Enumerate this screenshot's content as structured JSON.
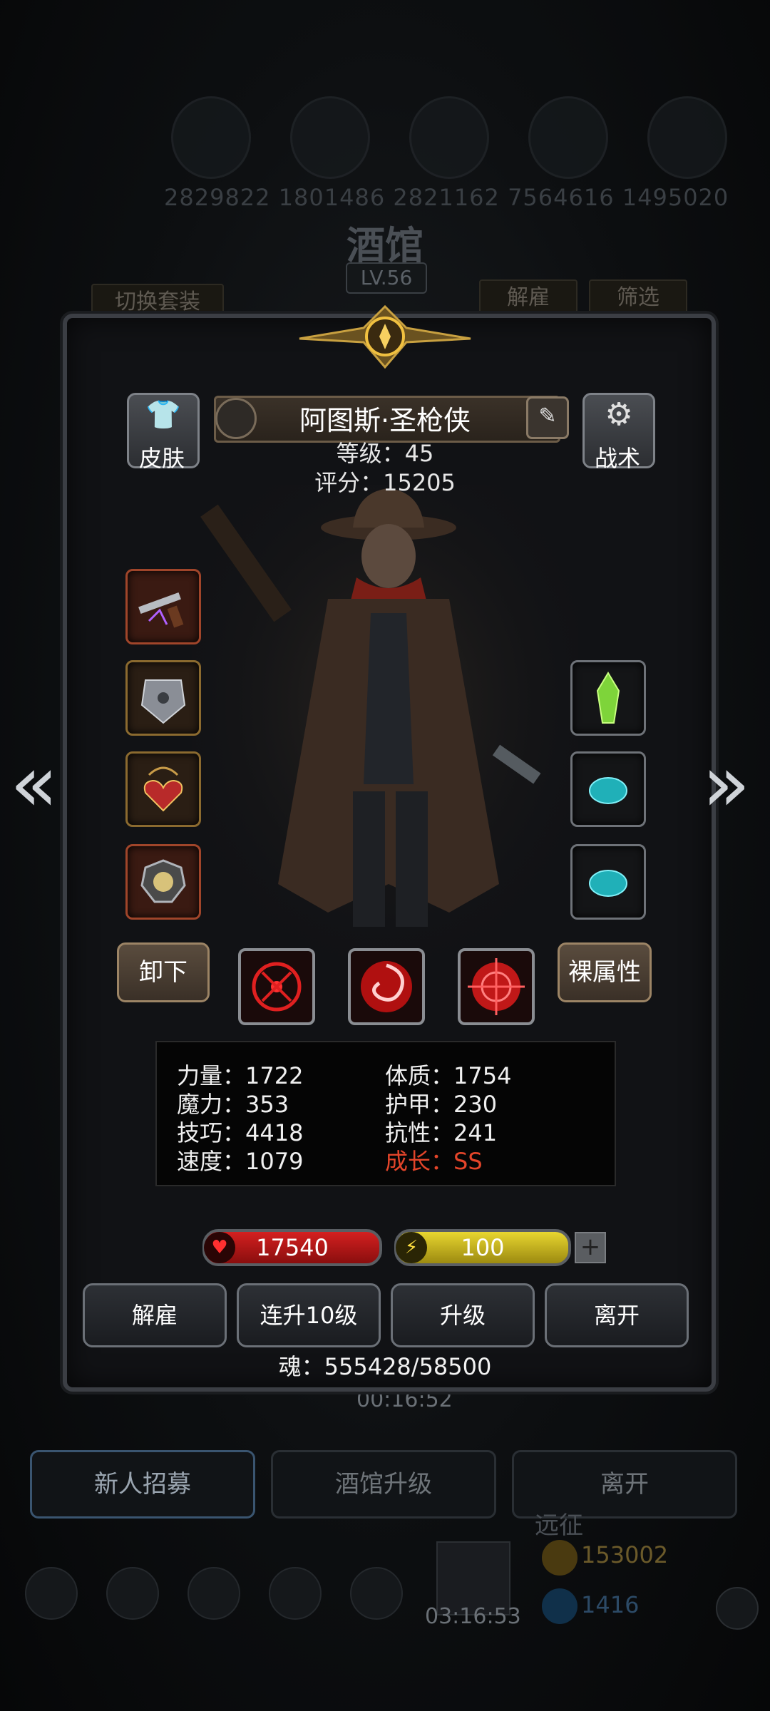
{
  "background": {
    "top_ids": "2829822 1801486 2821162 7564616 1495020",
    "screen_title": "酒馆",
    "level_badge": "LV.56",
    "switch_outfit_label": "切换套装",
    "dismiss_label": "解雇",
    "filter_label": "筛选",
    "timer_top": "00:16:52",
    "tabs": [
      "新人招募",
      "酒馆升级",
      "离开"
    ],
    "expedition_label": "远征",
    "gold": "153002",
    "gems": "1416",
    "timer_bottom": "03:16:53"
  },
  "hero": {
    "name": "阿图斯·圣枪侠",
    "level_line": "等级：45",
    "score_line": "评分：15205",
    "skin_label": "皮肤",
    "tactics_label": "战术",
    "unequip_label": "卸下",
    "bare_stats_label": "裸属性"
  },
  "attributes": {
    "left": [
      "力量：1722",
      "魔力：353",
      "技巧：4418",
      "速度：1079"
    ],
    "right": [
      "体质：1754",
      "护甲：230",
      "抗性：241"
    ],
    "growth": "成长：SS"
  },
  "bars": {
    "hp": "17540",
    "energy": "100",
    "plus": "+"
  },
  "actions": [
    "解雇",
    "连升10级",
    "升级",
    "离开"
  ],
  "soul": "魂：555428/58500",
  "icons": {
    "nav_prev": "double-chevron-left-icon",
    "nav_next": "double-chevron-right-icon",
    "heart": "heart-icon",
    "energy": "lightning-icon"
  },
  "colors": {
    "growth": "#e4452a",
    "hp": "#d42020",
    "energy": "#e8d630"
  }
}
